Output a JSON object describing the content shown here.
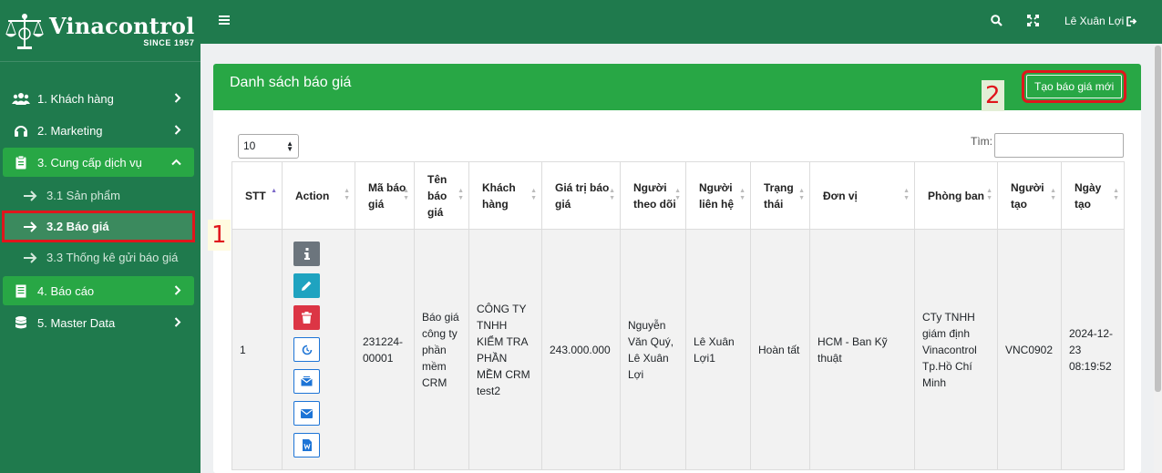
{
  "brand": {
    "name": "Vinacontrol",
    "since": "SINCE 1957"
  },
  "sidebar": {
    "items": [
      {
        "label": "1. Khách hàng"
      },
      {
        "label": "2. Marketing"
      },
      {
        "label": "3. Cung cấp dịch vụ"
      },
      {
        "label": "4. Báo cáo"
      },
      {
        "label": "5. Master Data"
      }
    ],
    "subitems": [
      {
        "label": "3.1 Sản phẩm"
      },
      {
        "label": "3.2 Báo giá"
      },
      {
        "label": "3.3 Thống kê gửi báo giá"
      }
    ]
  },
  "topbar": {
    "user_name": "Lê Xuân Lợi"
  },
  "card": {
    "title": "Danh sách báo giá",
    "new_button": "Tạo báo giá mới"
  },
  "annotations": {
    "first": "1",
    "second": "2"
  },
  "table_controls": {
    "page_length": "10",
    "search_label": "Tìm:"
  },
  "table": {
    "headers": [
      "STT",
      "Action",
      "Mã báo giá",
      "Tên báo giá",
      "Khách hàng",
      "Giá trị báo giá",
      "Người theo dõi",
      "Người liên hệ",
      "Trạng thái",
      "Đơn vị",
      "Phòng ban",
      "Người tạo",
      "Ngày tạo"
    ],
    "rows": [
      {
        "stt": "1",
        "code": "231224-00001",
        "name": "Báo giá công ty phần mềm CRM",
        "customer": "CÔNG TY TNHH KIỂM TRA PHẦN MỀM CRM test2",
        "value": "243.000.000",
        "followers": "Nguyễn Văn Quý, Lê Xuân Lợi",
        "contact": "Lê Xuân Lợi1",
        "status": "Hoàn tất",
        "unit": "HCM - Ban Kỹ thuật",
        "department": "CTy TNHH giám định Vinacontrol Tp.Hồ Chí Minh",
        "creator": "VNC0902",
        "created": "2024-12-23 08:19:52"
      }
    ]
  },
  "colors": {
    "primary_dark": "#1f7a4d",
    "primary": "#28a745",
    "highlight": "#e0161c"
  },
  "icons": [
    "users-icon",
    "headset-icon",
    "clipboard-icon",
    "report-icon",
    "database-icon",
    "chevron-right-icon",
    "chevron-up-icon",
    "arrow-right-icon",
    "menu-icon",
    "search-icon",
    "expand-icon",
    "logout-icon",
    "info-icon",
    "pencil-icon",
    "trash-icon",
    "history-icon",
    "mail-open-icon",
    "envelope-icon",
    "word-file-icon"
  ]
}
